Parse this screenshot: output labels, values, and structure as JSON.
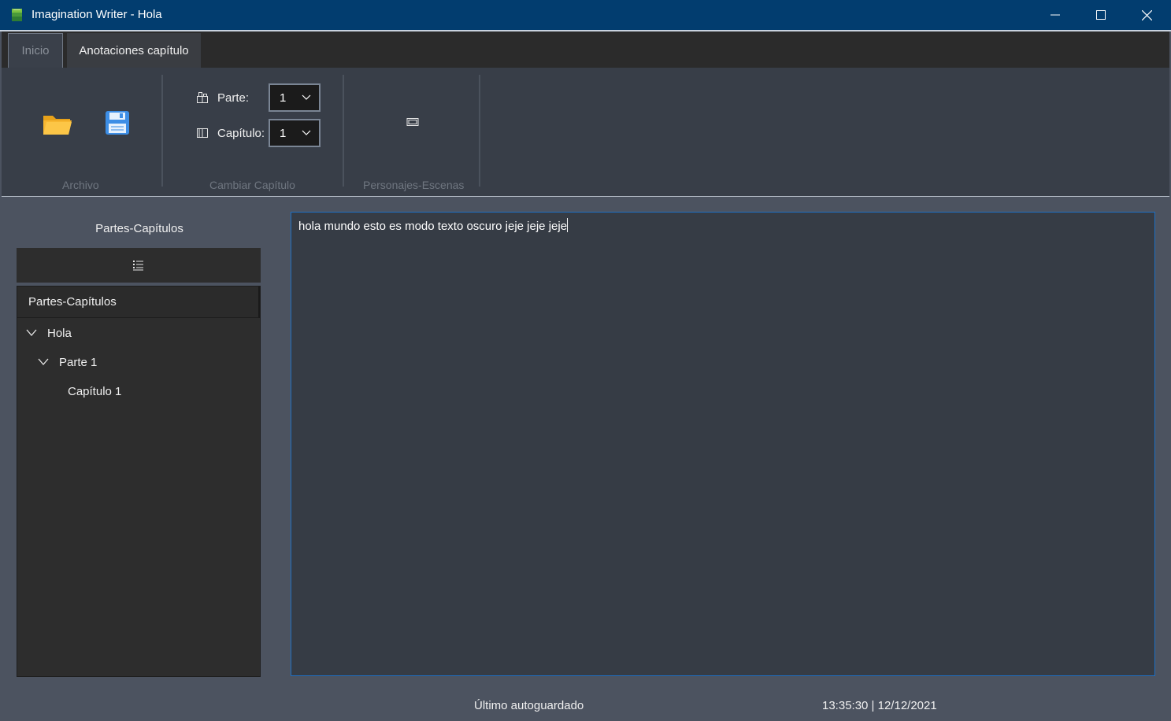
{
  "window": {
    "title": "Imagination Writer - Hola",
    "minimize_icon": "minimize-icon",
    "maximize_icon": "maximize-icon",
    "close_icon": "close-icon"
  },
  "ribbon": {
    "tabs": [
      {
        "label": "Inicio",
        "active": true
      },
      {
        "label": "Anotaciones capítulo",
        "active": false
      }
    ],
    "groups": {
      "archivo": {
        "label": "Archivo",
        "open_icon": "folder-open-icon",
        "save_icon": "floppy-save-icon"
      },
      "cambiar_capitulo": {
        "label": "Cambiar Capítulo",
        "parte_label": "Parte:",
        "parte_value": "1",
        "capitulo_label": "Capítulo:",
        "capitulo_value": "1"
      },
      "personajes_escenas": {
        "label": "Personajes-Escenas",
        "scene_icon": "window-frame-icon"
      }
    }
  },
  "sidebar": {
    "title": "Partes-Capítulos",
    "toolbar_icon": "list-icon",
    "tree_header": "Partes-Capítulos",
    "tree": [
      {
        "label": "Hola",
        "level": 0,
        "expanded": true
      },
      {
        "label": "Parte 1",
        "level": 1,
        "expanded": true
      },
      {
        "label": "Capítulo 1",
        "level": 2,
        "expanded": false
      }
    ]
  },
  "editor": {
    "text": "hola mundo esto es modo texto oscuro jeje jeje jeje"
  },
  "status": {
    "label": "Último autoguardado",
    "timestamp": "13:35:30 | 12/12/2021"
  },
  "colors": {
    "titlebar": "#023d6f",
    "ribbon": "#383e48",
    "main_bg": "#4c5360",
    "panel": "#2d2d2d",
    "editor_bg": "#363c45",
    "editor_border": "#1f6fc2"
  }
}
